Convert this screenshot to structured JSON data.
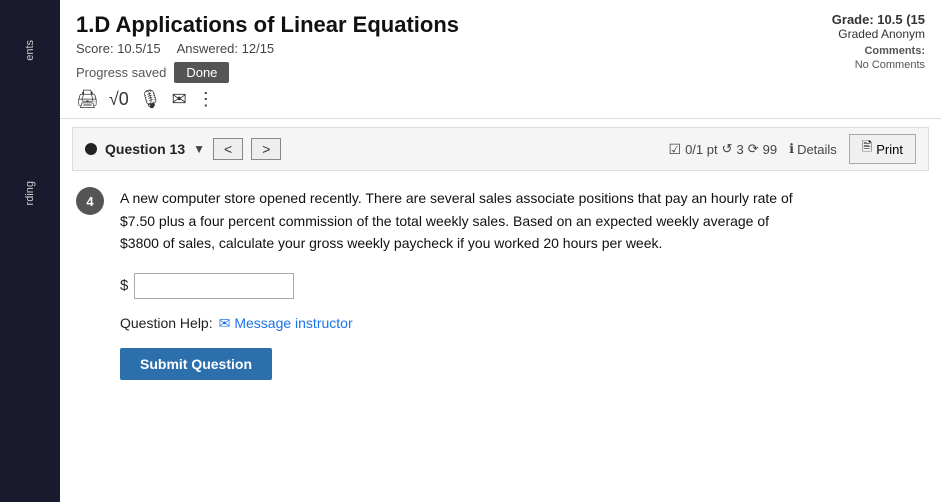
{
  "left_sidebar": {
    "label_top": "ents",
    "label_bottom": "rding"
  },
  "header": {
    "title": "1.D Applications of Linear Equations",
    "score_label": "Score:",
    "score_value": "10.5/15",
    "answered_label": "Answered:",
    "answered_value": "12/15",
    "progress_text": "Progress saved",
    "done_button": "Done",
    "grade_label": "Grade:",
    "grade_value": "10.5 (15",
    "graded_text": "Graded Anonym",
    "comments_label": "Comments:",
    "comments_value": "No Comments"
  },
  "toolbar": {
    "print_icon": "🖨",
    "sqrt_icon": "√0",
    "mail_icon": "✉",
    "more_icon": "⋮"
  },
  "question_nav": {
    "question_label": "Question 13",
    "prev_button": "<",
    "next_button": ">",
    "points_text": "0/1 pt",
    "retries_text": "3",
    "refresh_text": "99",
    "details_label": "Details",
    "print_button": "Print"
  },
  "question": {
    "number": "4",
    "text": "A new computer store opened recently. There are several sales associate positions that pay an hourly rate of $7.50 plus a four percent commission of the total weekly sales. Based on an expected weekly average of $3800 of sales, calculate your gross weekly paycheck if you worked 20 hours per week.",
    "dollar_sign": "$",
    "input_placeholder": "",
    "help_label": "Question Help:",
    "message_link": "Message instructor",
    "submit_button": "Submit Question"
  },
  "right_sidebar": {
    "grade_label": "Grade: 10.5 (15",
    "graded_text": "Graded Anonym",
    "comments_label": "Comments:",
    "comments_value": "No Comments"
  }
}
